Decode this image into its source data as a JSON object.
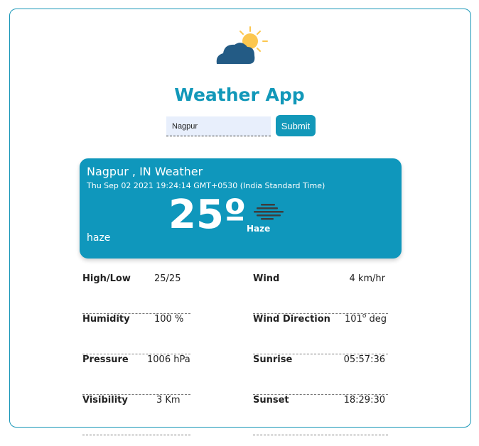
{
  "app": {
    "title": "Weather App"
  },
  "search": {
    "value": "Nagpur"
  },
  "submit_label": "Submit",
  "current": {
    "location": "Nagpur , IN Weather",
    "datetime": "Thu Sep 02 2021 19:24:14 GMT+0530 (India Standard Time)",
    "temperature": "25º",
    "condition_label": "Haze",
    "description": "haze",
    "condition_icon": "haze-icon"
  },
  "details": {
    "high_low": {
      "label": "High/Low",
      "value": "25/25"
    },
    "humidity": {
      "label": "Humidity",
      "value": "100 %"
    },
    "pressure": {
      "label": "Pressure",
      "value": "1006 hPa"
    },
    "visibility": {
      "label": "Visibility",
      "value": "3 Km"
    },
    "wind": {
      "label": "Wind",
      "value": "4 km/hr"
    },
    "wind_direction": {
      "label": "Wind Direction",
      "value_number": "101",
      "value_degree": "o",
      "value_unit": "deg"
    },
    "sunrise": {
      "label": "Sunrise",
      "value": "05:57:36"
    },
    "sunset": {
      "label": "Sunset",
      "value": "18:29:30"
    }
  },
  "colors": {
    "accent": "#1298b9",
    "card": "#0f97bc",
    "sun": "#fcc74f",
    "cloud": "#235b85"
  }
}
